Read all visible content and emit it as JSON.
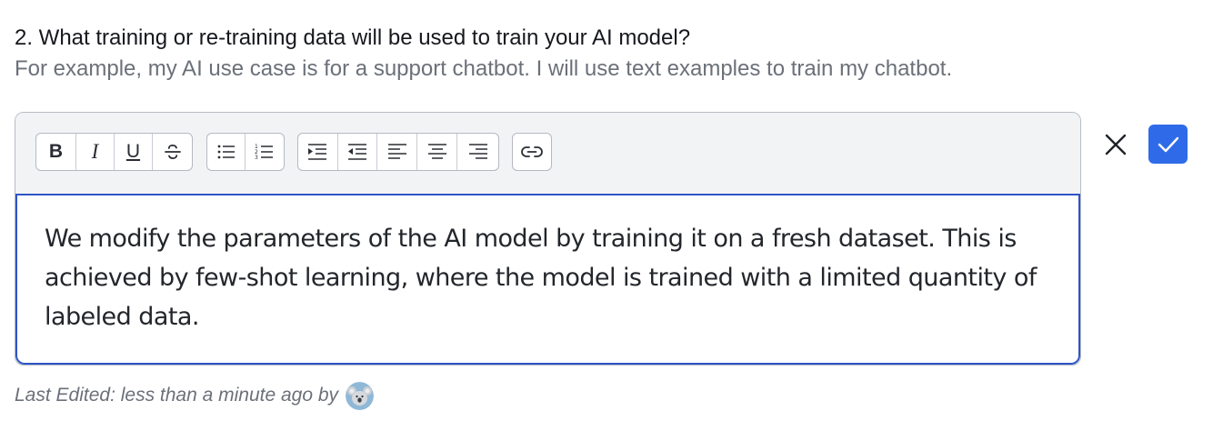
{
  "question": {
    "title": "2. What training or re-training data will be used to train your AI model?",
    "hint": "For example, my AI use case is for a support chatbot. I will use text examples to train my chatbot."
  },
  "toolbar": {
    "bold_label": "B",
    "italic_label": "I",
    "underline_label": "U",
    "icons": [
      "bold",
      "italic",
      "underline",
      "strikethrough-icon",
      "bulleted-list-icon",
      "numbered-list-icon",
      "indent-icon",
      "outdent-icon",
      "align-left-icon",
      "align-center-icon",
      "align-right-icon",
      "link-icon"
    ]
  },
  "editor": {
    "text": "We modify the parameters of the AI model by training it on a fresh dataset. This is achieved by few-shot learning, where the model is trained with a limited quantity of labeled data."
  },
  "actions": {
    "cancel_icon": "close-icon",
    "confirm_icon": "check-icon"
  },
  "footer": {
    "last_edited": "Last Edited: less than a minute ago by"
  },
  "colors": {
    "accent": "#2f6be8",
    "editor_focus_border": "#2f55c4",
    "toolbar_bg": "#f2f3f5",
    "muted_text": "#6b7079"
  }
}
